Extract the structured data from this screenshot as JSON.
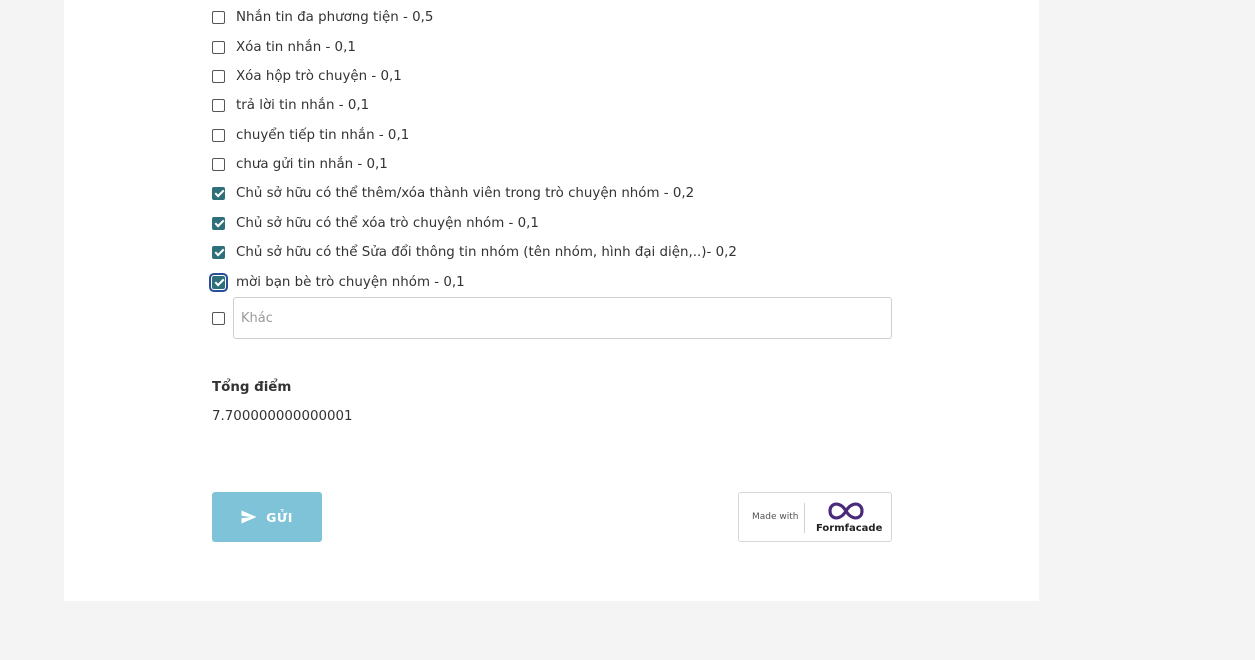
{
  "options": [
    {
      "label": "Nhắn tin đa phương tiện - 0,5",
      "checked": false
    },
    {
      "label": "Xóa tin nhắn - 0,1",
      "checked": false
    },
    {
      "label": "Xóa hộp trò chuyện - 0,1",
      "checked": false
    },
    {
      "label": "trả lời tin nhắn - 0,1",
      "checked": false
    },
    {
      "label": "chuyển tiếp tin nhắn - 0,1",
      "checked": false
    },
    {
      "label": "chưa gửi tin nhắn - 0,1",
      "checked": false
    },
    {
      "label": "Chủ sở hữu có thể thêm/xóa thành viên trong trò chuyện nhóm - 0,2",
      "checked": true
    },
    {
      "label": "Chủ sở hữu có thể xóa trò chuyện nhóm - 0,1",
      "checked": true
    },
    {
      "label": "Chủ sở hữu có thể Sửa đổi thông tin nhóm (tên nhóm, hình đại diện,..)- 0,2",
      "checked": true
    },
    {
      "label": "mời bạn bè trò chuyện nhóm - 0,1",
      "checked": true,
      "focused": true
    }
  ],
  "other": {
    "placeholder": "Khác",
    "value": "",
    "checked": false
  },
  "score": {
    "title": "Tổng điểm",
    "value": "7.700000000000001"
  },
  "submit": {
    "label": "GỬI",
    "icon": "send-icon"
  },
  "badge": {
    "made_with": "Made with",
    "brand": "Formfacade",
    "icon": "formfacade-logo-icon"
  },
  "colors": {
    "page_bg": "#f4f4f4",
    "card_bg": "#ffffff",
    "checkbox_checked": "#2f6f7a",
    "submit_bg": "#7fc3d8",
    "logo": "#4a2a7a"
  }
}
